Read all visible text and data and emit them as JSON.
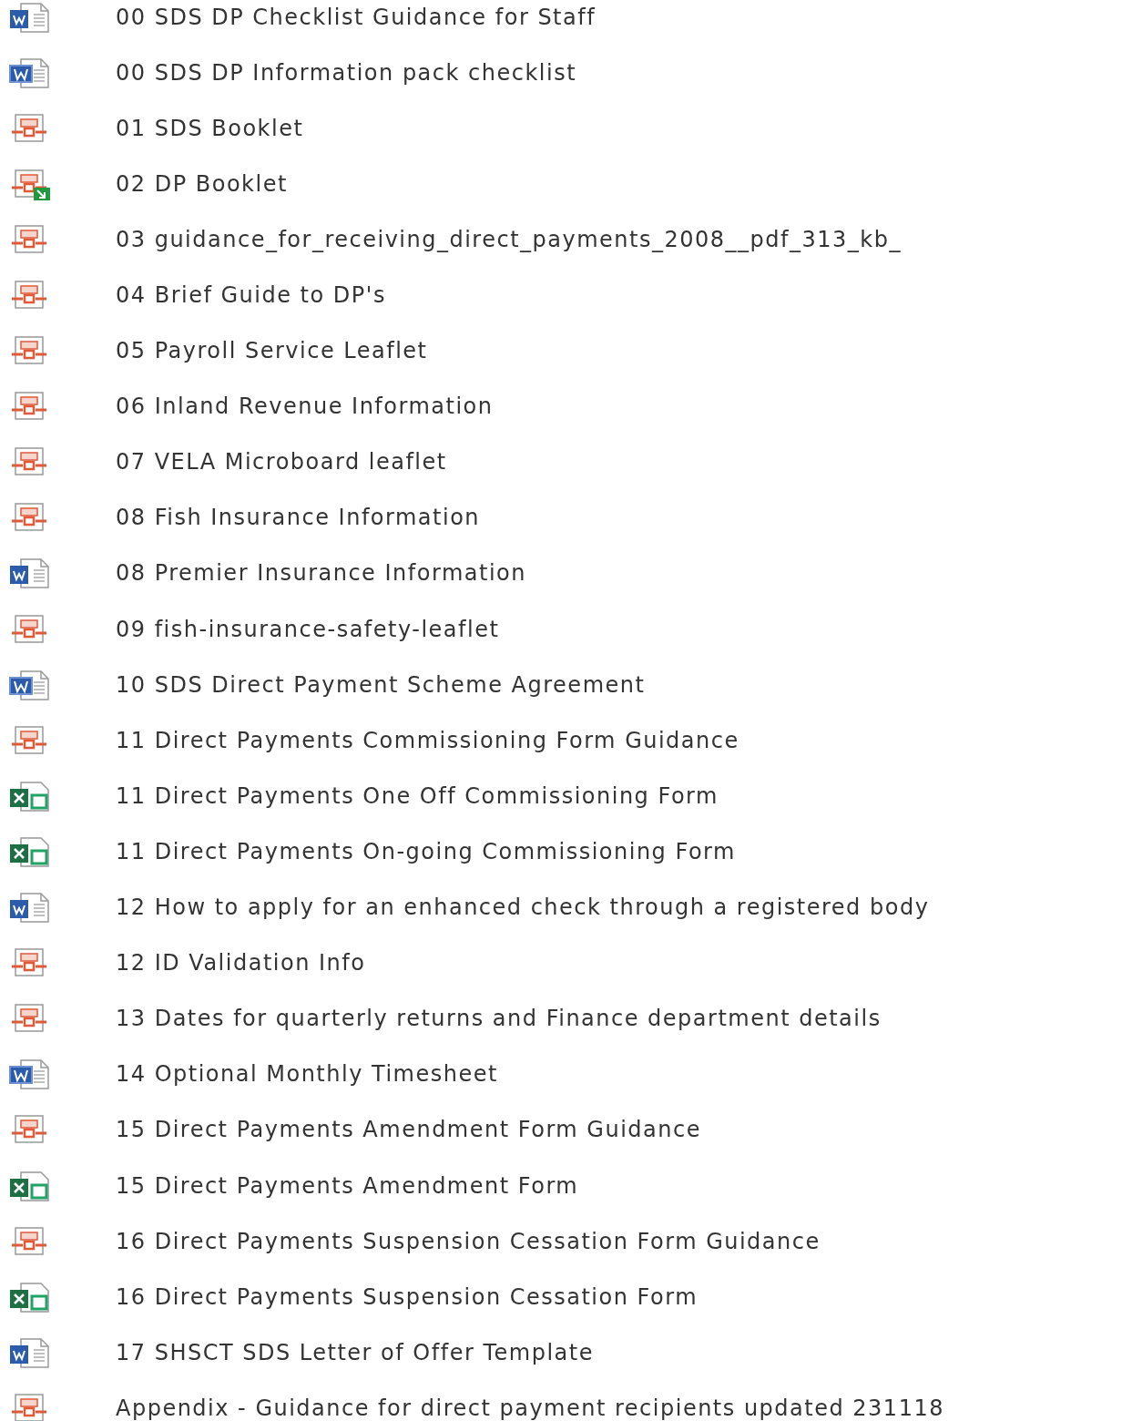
{
  "files": [
    {
      "kind": "docx",
      "name": "00 SDS DP Checklist Guidance for Staff"
    },
    {
      "kind": "doc",
      "name": "00 SDS DP Information pack checklist"
    },
    {
      "kind": "pdf",
      "name": "01 SDS Booklet"
    },
    {
      "kind": "pdf-link",
      "name": "02 DP Booklet"
    },
    {
      "kind": "pdf",
      "name": "03 guidance_for_receiving_direct_payments_2008__pdf_313_kb_"
    },
    {
      "kind": "pdf",
      "name": "04 Brief Guide to DP's"
    },
    {
      "kind": "pdf",
      "name": "05 Payroll Service Leaflet"
    },
    {
      "kind": "pdf",
      "name": "06 Inland Revenue Information"
    },
    {
      "kind": "pdf",
      "name": "07 VELA Microboard leaflet"
    },
    {
      "kind": "pdf",
      "name": "08 Fish Insurance Information"
    },
    {
      "kind": "docx",
      "name": "08 Premier Insurance Information"
    },
    {
      "kind": "pdf",
      "name": "09 fish-insurance-safety-leaflet"
    },
    {
      "kind": "doc",
      "name": "10 SDS Direct Payment Scheme Agreement"
    },
    {
      "kind": "pdf",
      "name": "11 Direct Payments Commissioning Form Guidance"
    },
    {
      "kind": "xlsx",
      "name": "11 Direct Payments One Off Commissioning Form"
    },
    {
      "kind": "xlsx",
      "name": "11 Direct Payments On-going Commissioning Form"
    },
    {
      "kind": "docx",
      "name": "12 How to apply for an enhanced check through a registered body"
    },
    {
      "kind": "pdf",
      "name": "12 ID Validation Info"
    },
    {
      "kind": "pdf",
      "name": "13 Dates for quarterly returns and Finance department details"
    },
    {
      "kind": "doc",
      "name": "14 Optional Monthly Timesheet"
    },
    {
      "kind": "pdf",
      "name": "15 Direct Payments Amendment Form Guidance"
    },
    {
      "kind": "xlsx",
      "name": "15 Direct Payments Amendment Form"
    },
    {
      "kind": "pdf",
      "name": "16 Direct Payments Suspension Cessation Form Guidance"
    },
    {
      "kind": "xlsx",
      "name": "16 Direct Payments Suspension Cessation Form"
    },
    {
      "kind": "docx",
      "name": "17 SHSCT SDS Letter of Offer Template"
    },
    {
      "kind": "pdf",
      "name": "Appendix - Guidance for direct payment recipients updated 231118"
    }
  ]
}
